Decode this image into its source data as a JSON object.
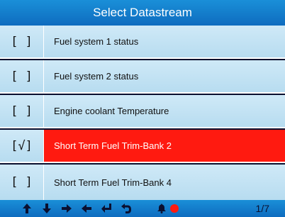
{
  "header": {
    "title": "Select Datastream"
  },
  "list": {
    "items": [
      {
        "check": "[ ]",
        "label": "Fuel system  1  status",
        "selected": false
      },
      {
        "check": "[ ]",
        "label": "Fuel system  2  status",
        "selected": false
      },
      {
        "check": "[ ]",
        "label": "Engine coolant Temperature",
        "selected": false
      },
      {
        "check": "[√]",
        "label": "Short Term Fuel Trim-Bank 2",
        "selected": true
      },
      {
        "check": "[ ]",
        "label": "Short Term Fuel Trim-Bank 4",
        "selected": false
      }
    ]
  },
  "status_bar": {
    "icons": [
      "up-arrow-icon",
      "down-arrow-icon",
      "right-arrow-icon",
      "left-arrow-icon",
      "enter-icon",
      "back-icon",
      "bell-icon",
      "record-icon"
    ],
    "page": "1/7"
  },
  "colors": {
    "title_bar": "#1a8fd8",
    "row_bg": "#cfe9f7",
    "selected_bg": "#ff1a10",
    "record": "#ff1a10"
  }
}
